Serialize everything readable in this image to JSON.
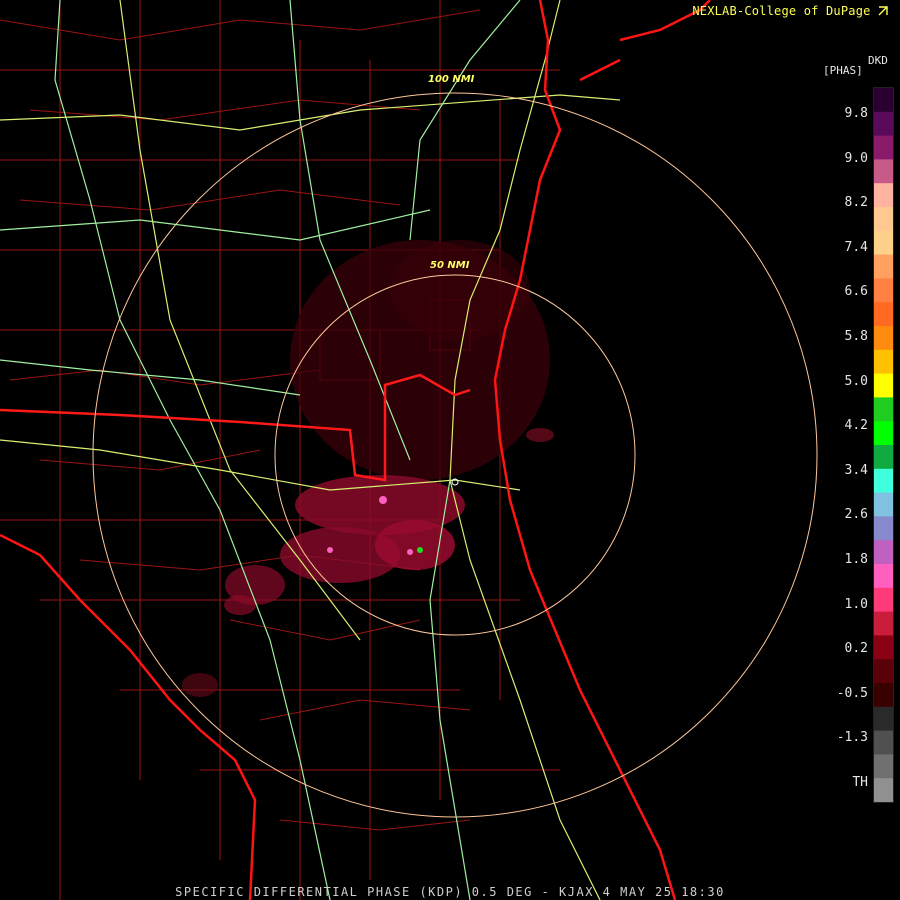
{
  "header": {
    "credit": "NEXLAB-College of DuPage"
  },
  "footer": {
    "caption": "SPECIFIC DIFFERENTIAL PHASE (KDP) 0.5 DEG - KJAX 4 MAY 25 18:30"
  },
  "legend": {
    "product_code": "DKD",
    "units": "[PHAS]",
    "labels": [
      "9.8",
      "9.0",
      "8.2",
      "7.4",
      "6.6",
      "5.8",
      "5.0",
      "4.2",
      "3.4",
      "2.6",
      "1.8",
      "1.0",
      "0.2",
      "-0.5",
      "-1.3",
      "TH"
    ],
    "colors": [
      "#2a0030",
      "#5a0a5a",
      "#8a1a6a",
      "#c85a8a",
      "#ffb3a0",
      "#ffc890",
      "#ffd08a",
      "#ffa060",
      "#ff8040",
      "#ff6a20",
      "#ff8a10",
      "#ffc000",
      "#ffff00",
      "#20cc20",
      "#00ff00",
      "#10aa40",
      "#40ffdd",
      "#80c0e0",
      "#8888cc",
      "#c060c0",
      "#ff60c0",
      "#ff3a78",
      "#c81e3c",
      "#8a0014",
      "#5a0008",
      "#3a0000",
      "#2a2a2a",
      "#505050",
      "#707070",
      "#909090"
    ]
  },
  "range_rings": {
    "label_50": "50 NMI",
    "label_100": "100 NMI"
  },
  "map_colors": {
    "background": "#000000",
    "coastline": "#ff1414",
    "state_border": "#ff1a1a",
    "county_border": "#a01414",
    "highways": "#d8f070",
    "interstates": "#a0f0a0",
    "range_ring": "#ffc89a"
  },
  "icons": [
    "radar-site-marker-icon",
    "logo-arrow-icon"
  ]
}
